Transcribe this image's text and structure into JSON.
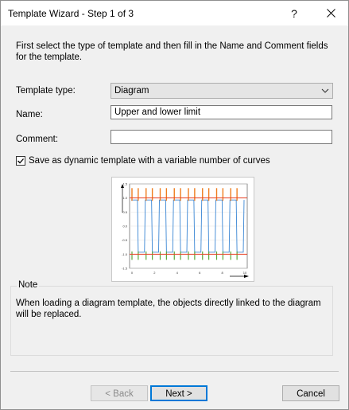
{
  "window": {
    "title": "Template Wizard - Step 1 of 3",
    "help_label": "?",
    "close_label": "✕"
  },
  "intro": "First select the type of template and then fill in the Name and Comment fields for the template.",
  "template_type": {
    "label": "Template type:",
    "value": "Diagram"
  },
  "name": {
    "label": "Name:",
    "value": "Upper and lower limit"
  },
  "comment": {
    "label": "Comment:",
    "value": ""
  },
  "dynamic": {
    "label": "Save as dynamic template with a variable number of curves",
    "checked": true
  },
  "preview": {
    "y_ticks": [
      "1.5",
      "1.0",
      "0.5",
      "0.0",
      "-0.5",
      "-1.0",
      "-1.5"
    ],
    "x_ticks": [
      "0",
      "2",
      "4",
      "6",
      "8",
      "10"
    ],
    "limits": {
      "upper": 1.0,
      "lower": -1.0
    },
    "colors": {
      "limit": "#e8452a",
      "signal": "#3a86d4",
      "spike_up": "#f07d1e",
      "spike_down": "#5aa83a"
    }
  },
  "note": {
    "title": "Note",
    "text": "When loading a diagram template, the objects directly linked to the diagram will be replaced."
  },
  "buttons": {
    "back": "< Back",
    "next": "Next >",
    "cancel": "Cancel"
  }
}
